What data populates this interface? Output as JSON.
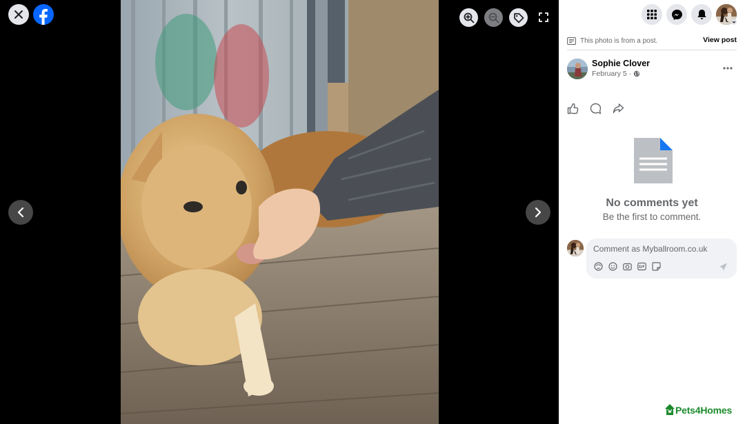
{
  "viewer": {
    "icons": {
      "close": "close-icon",
      "facebook_logo": "facebook-logo-icon",
      "zoom_in": "zoom-in-icon",
      "zoom_out": "zoom-out-icon",
      "tag": "tag-icon",
      "fullscreen": "fullscreen-icon",
      "previous": "chevron-left-icon",
      "next": "chevron-right-icon"
    }
  },
  "topbar": {
    "icons": [
      "menu-grid-icon",
      "messenger-icon",
      "bell-icon",
      "profile-avatar"
    ]
  },
  "post_notice": {
    "text": "This photo is from a post.",
    "view_post": "View post"
  },
  "author": {
    "name": "Sophie Clover",
    "date": "February 5 ·"
  },
  "actions": [
    "like-icon",
    "comment-icon",
    "share-icon"
  ],
  "comments": {
    "empty_title": "No comments yet",
    "empty_subtitle": "Be the first to comment.",
    "placeholder": "Comment as Myballroom.co.uk",
    "tools": [
      "avatar-sticker-icon",
      "emoji-icon",
      "camera-icon",
      "gif-icon",
      "sticker-icon"
    ]
  },
  "watermark": {
    "text": "Pets4Homes"
  },
  "colors": {
    "brand_blue": "#0866ff",
    "watermark_green": "#1c8a2c",
    "muted_text": "#65676b",
    "panel_bg": "#ffffff"
  }
}
